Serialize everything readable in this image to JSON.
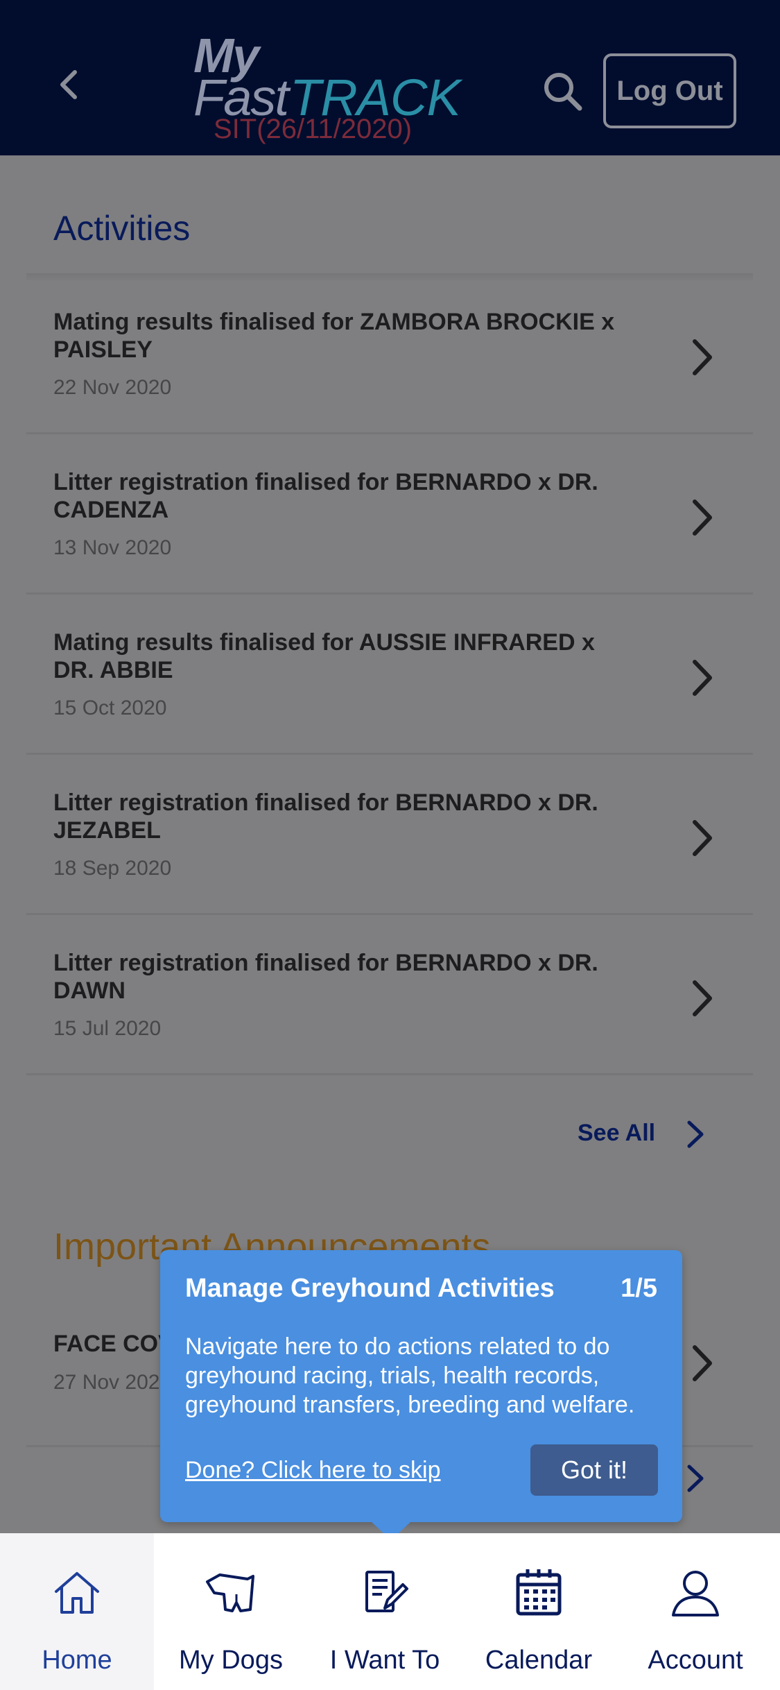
{
  "header": {
    "logo_my": "My",
    "logo_fast": "Fast",
    "logo_track": "TRACK",
    "environment": "SIT(26/11/2020)",
    "logout_label": "Log Out"
  },
  "activities": {
    "title": "Activities",
    "items": [
      {
        "title": "Mating results finalised for ZAMBORA BROCKIE x PAISLEY",
        "date": "22 Nov 2020"
      },
      {
        "title": "Litter registration finalised for BERNARDO x DR. CADENZA",
        "date": "13 Nov 2020"
      },
      {
        "title": "Mating results finalised for AUSSIE INFRARED x DR. ABBIE",
        "date": "15 Oct 2020"
      },
      {
        "title": "Litter registration finalised for BERNARDO x DR. JEZABEL",
        "date": "18 Sep 2020"
      },
      {
        "title": "Litter registration finalised for BERNARDO x DR. DAWN",
        "date": "15 Jul 2020"
      }
    ],
    "see_all_label": "See All"
  },
  "announcements": {
    "title": "Important Announcements",
    "item_title": "FACE COV",
    "item_date": "27 Nov 202"
  },
  "tooltip": {
    "title": "Manage Greyhound Activities",
    "step": "1/5",
    "body": "Navigate here to do actions related to do greyhound racing, trials, health records, greyhound transfers, breeding and welfare.",
    "skip_label": "Done? Click here to skip",
    "got_it_label": "Got it!"
  },
  "tabbar": {
    "tabs": [
      {
        "label": "Home",
        "icon": "home-icon",
        "active": true
      },
      {
        "label": "My Dogs",
        "icon": "dog-icon",
        "active": false
      },
      {
        "label": "I Want To",
        "icon": "edit-document-icon",
        "active": false
      },
      {
        "label": "Calendar",
        "icon": "calendar-icon",
        "active": false
      },
      {
        "label": "Account",
        "icon": "account-icon",
        "active": false
      }
    ]
  },
  "colors": {
    "header_bg": "#020d2e",
    "overlay_bg": "#7f7f81",
    "tooltip_bg": "#4a8fe0",
    "accent_blue": "#1f3f9a",
    "announcement_orange": "#7c5416"
  }
}
